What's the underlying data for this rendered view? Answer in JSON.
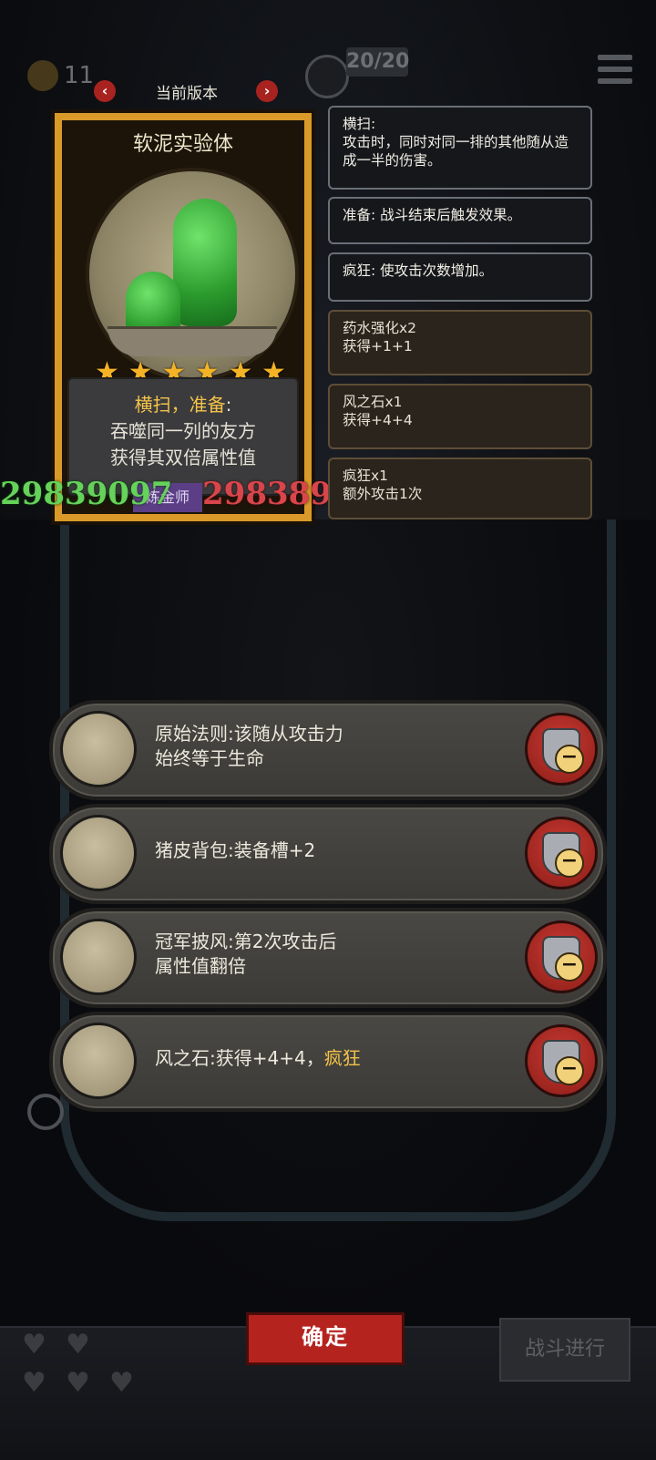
{
  "hud": {
    "coins": "11",
    "hp": "20/20"
  },
  "version": {
    "label": "当前版本",
    "prev": "‹",
    "next": "›"
  },
  "card": {
    "name": "软泥实验体",
    "stars": 6,
    "desc_keyword": "横扫，准备",
    "desc_colon": ":",
    "desc_line2": "吞噬同一列的友方",
    "desc_line3": "获得其双倍属性值",
    "attack": "29839097",
    "job": "炼金师",
    "health": "298389"
  },
  "tips": [
    {
      "title": "横扫:",
      "body": "攻击时，同时对同一排的其他随从造成一半的伤害。",
      "style": "normal"
    },
    {
      "title": "准备:",
      "body": "战斗结束后触发效果。",
      "style": "normal"
    },
    {
      "title": "疯狂:",
      "body": "使攻击次数增加。",
      "style": "normal"
    },
    {
      "title": "药水强化x2",
      "body": "获得+1+1",
      "style": "alt"
    },
    {
      "title": "风之石x1",
      "body": "获得+4+4",
      "style": "alt"
    },
    {
      "title": "疯狂x1",
      "body": "额外攻击1次",
      "style": "alt"
    }
  ],
  "items": [
    {
      "icon": "scales-icon",
      "text_line1": "原始法则:该随从攻击力",
      "text_line2": "始终等于生命",
      "kw": ""
    },
    {
      "icon": "backpack-icon",
      "text_line1": "猪皮背包:装备槽+2",
      "text_line2": "",
      "kw": ""
    },
    {
      "icon": "cloak-icon",
      "text_line1": "冠军披风:第2次攻击后",
      "text_line2": "属性值翻倍",
      "kw": ""
    },
    {
      "icon": "wind-stone-icon",
      "text_line1": "风之石:获得+4+4，",
      "text_line2": "",
      "kw": "疯狂"
    }
  ],
  "remove_icon": "shield-minus-icon",
  "buttons": {
    "confirm": "确定",
    "battle": "战斗进行"
  }
}
